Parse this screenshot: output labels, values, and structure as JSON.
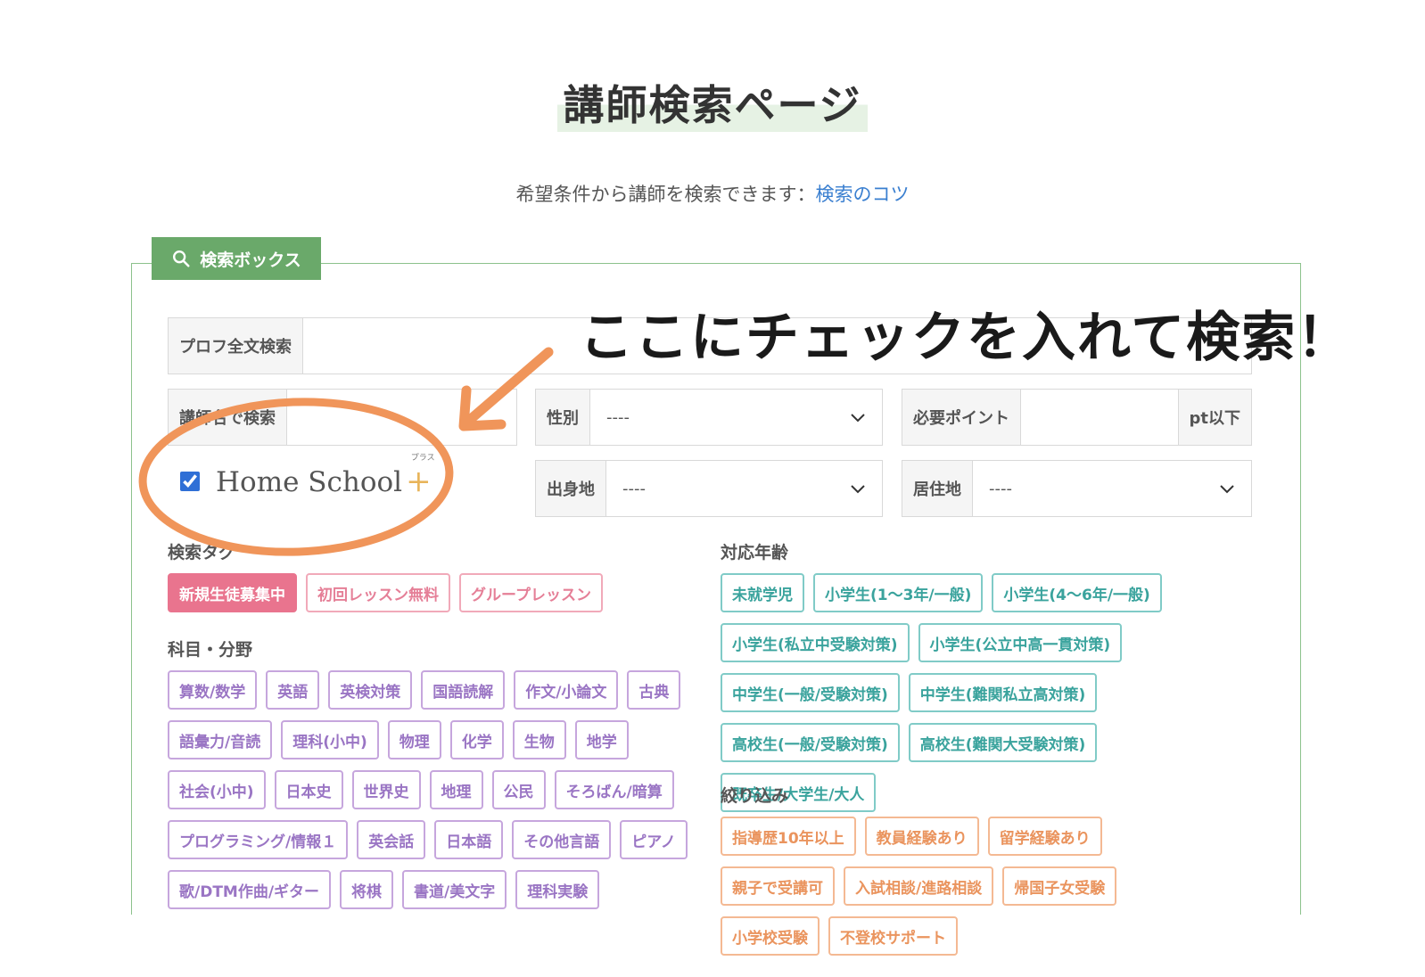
{
  "page": {
    "title": "講師検索ページ",
    "subtitle": "希望条件から講師を検索できます：",
    "tips_link": "検索のコツ"
  },
  "search_box": {
    "tab_label": "検索ボックス",
    "fulltext_label": "プロフ全文検索",
    "name_label": "講師名で検索",
    "gender_label": "性別",
    "gender_value": "----",
    "points_label": "必要ポイント",
    "points_suffix": "pt以下",
    "birthplace_label": "出身地",
    "birthplace_value": "----",
    "residence_label": "居住地",
    "residence_value": "----",
    "homeschool_text": "Home School",
    "homeschool_plus": "+",
    "homeschool_ruby": "プラス",
    "homeschool_checked": true
  },
  "annotation": {
    "callout": "ここにチェックを入れて検索！",
    "color": "#f0955a"
  },
  "tags": {
    "title": "検索タグ",
    "items": [
      "新規生徒募集中",
      "初回レッスン無料",
      "グループレッスン"
    ]
  },
  "subjects": {
    "title": "科目・分野",
    "items": [
      "算数/数学",
      "英語",
      "英検対策",
      "国語読解",
      "作文/小論文",
      "古典",
      "語彙力/音読",
      "理科(小中)",
      "物理",
      "化学",
      "生物",
      "地学",
      "社会(小中)",
      "日本史",
      "世界史",
      "地理",
      "公民",
      "そろばん/暗算",
      "プログラミング/情報１",
      "英会話",
      "日本語",
      "その他言語",
      "ピアノ",
      "歌/DTM作曲/ギター",
      "将棋",
      "書道/美文字",
      "理科実験"
    ]
  },
  "ages": {
    "title": "対応年齢",
    "items": [
      "未就学児",
      "小学生(1〜3年/一般)",
      "小学生(4〜6年/一般)",
      "小学生(私立中受験対策)",
      "小学生(公立中高一貫対策)",
      "中学生(一般/受験対策)",
      "中学生(難関私立高対策)",
      "高校生(一般/受験対策)",
      "高校生(難関大受験対策)",
      "既卒生/大学生/大人"
    ]
  },
  "filters": {
    "title": "絞り込み",
    "items": [
      "指導歴10年以上",
      "教員経験あり",
      "留学経験あり",
      "親子で受講可",
      "入試相談/進路相談",
      "帰国子女受験",
      "小学校受験",
      "不登校サポート"
    ]
  }
}
